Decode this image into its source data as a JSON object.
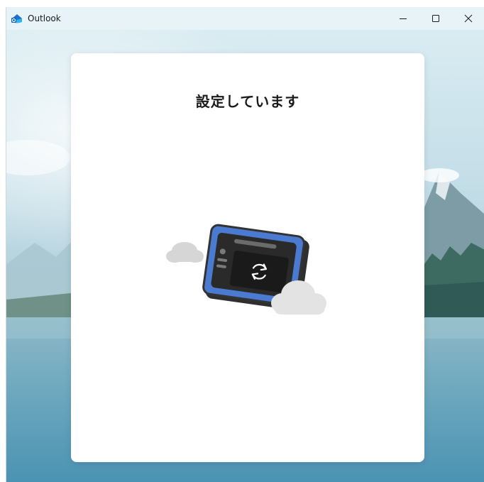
{
  "window": {
    "title": "Outlook",
    "icon": "outlook-app-icon",
    "controls": {
      "minimize": "minimize-icon",
      "maximize": "maximize-icon",
      "close": "close-icon"
    }
  },
  "dialog": {
    "heading": "設定しています",
    "illustration": "sync-device-illustration"
  },
  "colors": {
    "titlebar": "#e8f3f7",
    "device_frame": "#4b79c9",
    "device_bezel": "#3a3a3a",
    "cloud": "#d9d9d9"
  }
}
